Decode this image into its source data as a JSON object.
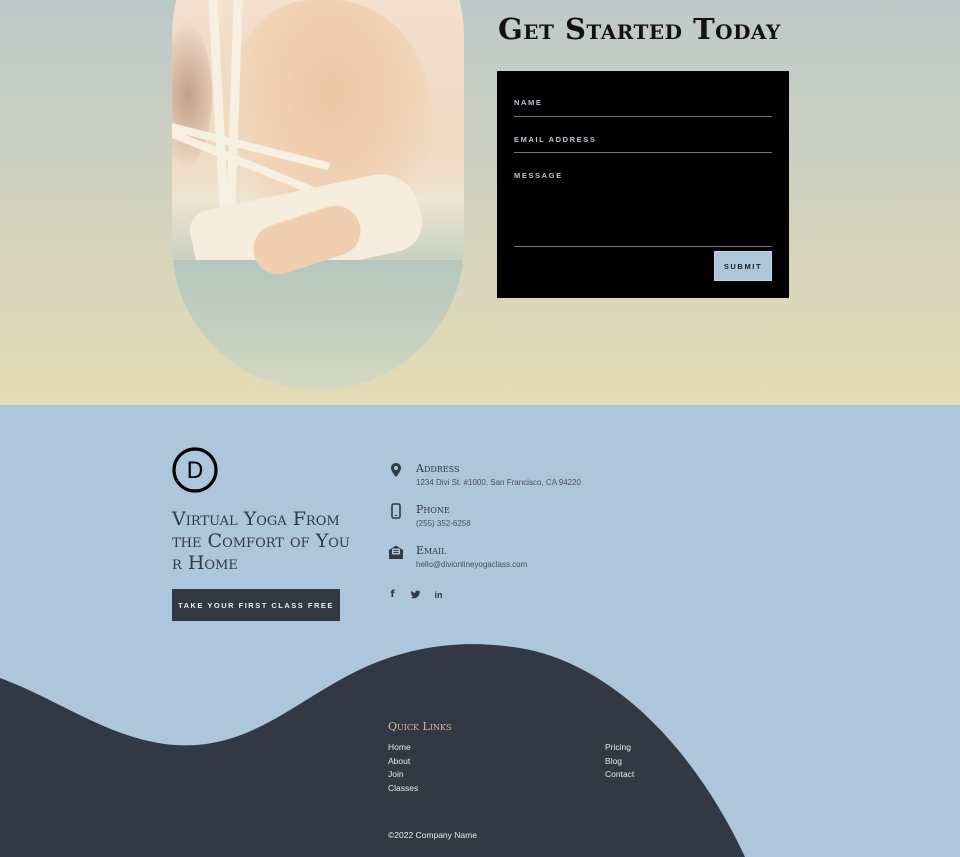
{
  "hero": {
    "title": "Get Started Today",
    "image_alt": "woman in yoga pose with hands clasped behind back",
    "form": {
      "fields": [
        {
          "label": "NAME",
          "value": ""
        },
        {
          "label": "EMAIL ADDRESS",
          "value": ""
        },
        {
          "label": "MESSAGE",
          "value": ""
        }
      ],
      "submit_label": "SUBMIT"
    }
  },
  "contact": {
    "logo_letter": "D",
    "tagline": "Virtual Yoga From the Comfort of Your Home",
    "cta_label": "TAKE YOUR FIRST CLASS FREE",
    "items": [
      {
        "icon": "map-pin-icon",
        "heading": "Address",
        "value": "1234 Divi St. #1000, San Francisco, CA 94220"
      },
      {
        "icon": "phone-icon",
        "heading": "Phone",
        "value": "(255) 352-6258"
      },
      {
        "icon": "email-icon",
        "heading": "Email",
        "value": "hello@divionlineyogaclass.com"
      }
    ],
    "social": [
      {
        "icon": "facebook-icon",
        "glyph": "f"
      },
      {
        "icon": "twitter-icon",
        "glyph": "🐦"
      },
      {
        "icon": "linkedin-icon",
        "glyph": "in"
      }
    ]
  },
  "footer": {
    "quick_links_title": "Quick Links",
    "links_left": [
      "Home",
      "About",
      "Join",
      "Classes"
    ],
    "links_right": [
      "Pricing",
      "Blog",
      "Contact"
    ],
    "copyright": "©2022 Company Name"
  },
  "colors": {
    "hero_top": "#bccac8",
    "hero_bottom": "#e6dcb5",
    "light_blue": "#adc6dc",
    "dark_navy": "#333845",
    "gold": "#d6b98c"
  }
}
